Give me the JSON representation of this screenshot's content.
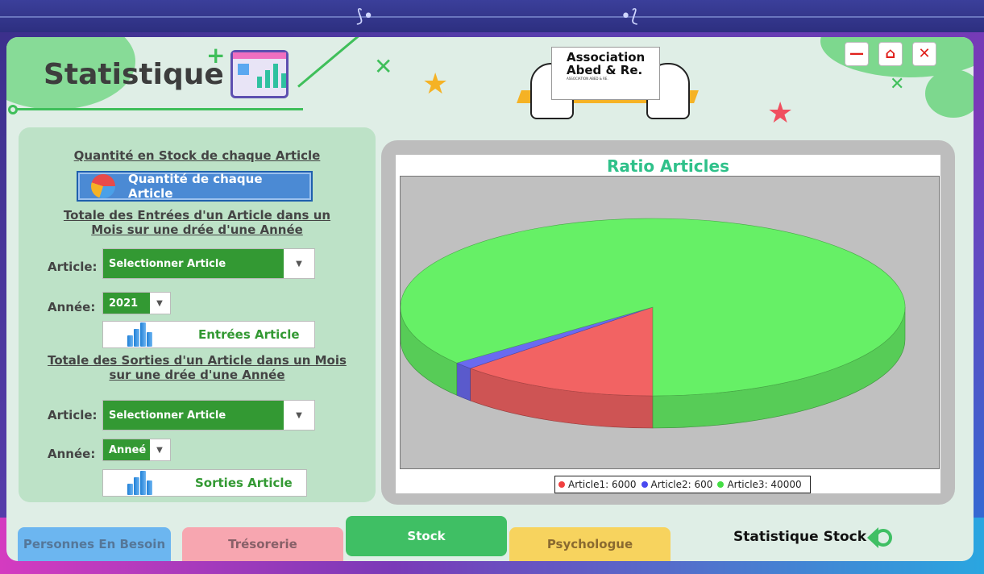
{
  "header": {
    "title": "Statistique",
    "logo_text": "Association Abed & Re.",
    "logo_subtitle": "ASSOCIATION ABED & RE.",
    "window_buttons": {
      "minimize": "—",
      "home": "⌂",
      "close": "✕"
    }
  },
  "left_panel": {
    "section1_title": "Quantité en Stock de chaque Article",
    "qty_button_label": "Quantité de chaque Article",
    "section2_title_line1": "Totale des Entrées d'un Article dans un",
    "section2_title_line2": "Mois sur une drée d'une Année",
    "article_label": "Article:",
    "article_select_value": "Selectionner Article",
    "annee_label": "Année:",
    "annee_select_value": "2021",
    "entrees_button_label": "Entrées Article",
    "section3_title_line1": "Totale des Sorties d'un Article dans un Mois",
    "section3_title_line2": "sur une drée d'une Année",
    "article2_label": "Article:",
    "article2_select_value": "Selectionner Article",
    "annee2_label": "Année:",
    "annee2_select_value": "Anneé",
    "sorties_button_label": "Sorties Article"
  },
  "chart_data": {
    "type": "pie",
    "title": "Ratio Articles",
    "three_d": true,
    "categories": [
      "Article1",
      "Article2",
      "Article3"
    ],
    "values": [
      6000,
      600,
      40000
    ],
    "colors": [
      "#f26363",
      "#6a6af0",
      "#66f066"
    ],
    "legend": [
      "Article1: 6000",
      "Article2: 600",
      "Article3: 40000"
    ],
    "legend_position": "bottom"
  },
  "tabs": [
    {
      "label": "Personnes En Besoin",
      "color": "#6cb6f0",
      "text_color": "#557799",
      "active": false
    },
    {
      "label": "Trésorerie",
      "color": "#f7a6b0",
      "text_color": "#886068",
      "active": false
    },
    {
      "label": "Stock",
      "color": "#3fbf64",
      "text_color": "#ffffff",
      "active": true
    },
    {
      "label": "Psychologue",
      "color": "#f7d35e",
      "text_color": "#8a6a30",
      "active": false
    }
  ],
  "footer": {
    "page_label": "Statistique Stock"
  },
  "colors": {
    "accent_green": "#339933",
    "panel_bg": "#bde2c7",
    "window_bg": "#dfeee6"
  }
}
